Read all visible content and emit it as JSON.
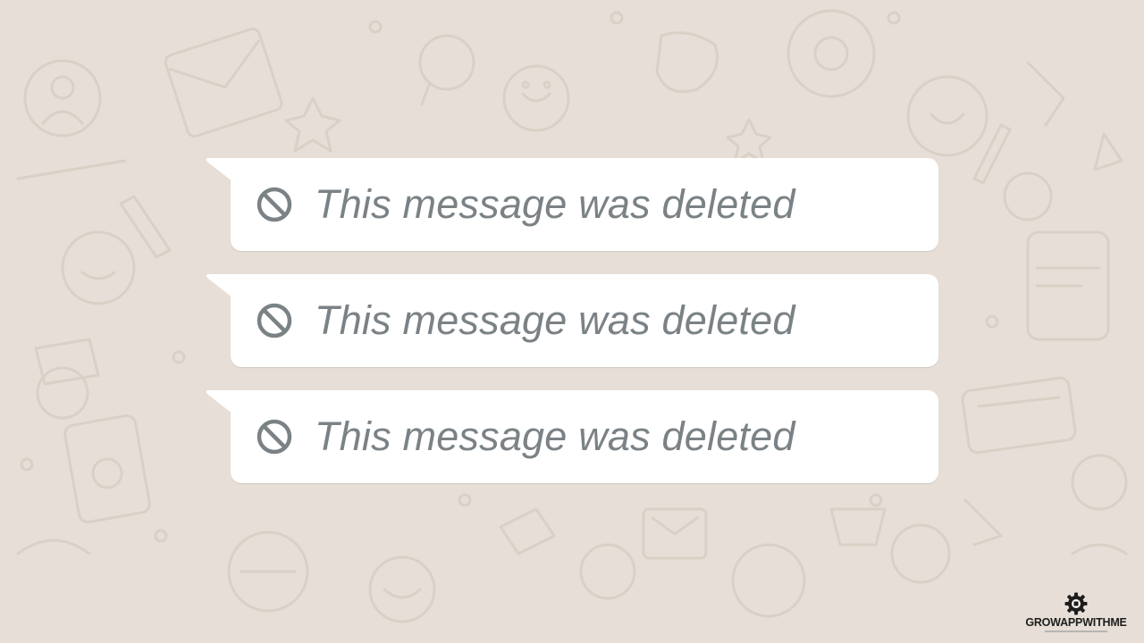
{
  "chat": {
    "background_color": "#e7dfd7",
    "bubble_color": "#ffffff",
    "messages": [
      {
        "text": "This message was deleted",
        "icon": "deleted-message-icon"
      },
      {
        "text": "This message was deleted",
        "icon": "deleted-message-icon"
      },
      {
        "text": "This message was deleted",
        "icon": "deleted-message-icon"
      }
    ]
  },
  "watermark": {
    "name": "GROWAPPWITHME",
    "logo_icon": "gear-logo-icon"
  }
}
